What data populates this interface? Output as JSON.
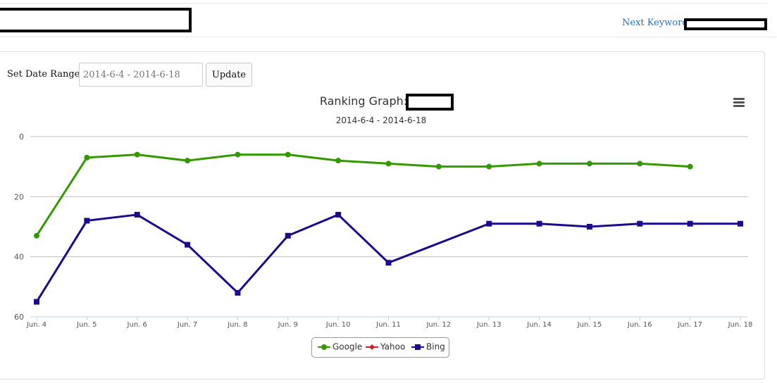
{
  "header": {
    "next_link": "Next Keyword"
  },
  "controls": {
    "date_label": "Set Date Range :",
    "date_value": "2014-6-4 - 2014-6-18",
    "update_label": "Update"
  },
  "chart_data": {
    "type": "line",
    "title": "Ranking Graph:",
    "subtitle": "2014-6-4 - 2014-6-18",
    "categories": [
      "Jun. 4",
      "Jun. 5",
      "Jun. 6",
      "Jun. 7",
      "Jun. 8",
      "Jun. 9",
      "Jun. 10",
      "Jun. 11",
      "Jun. 12",
      "Jun. 13",
      "Jun. 14",
      "Jun. 15",
      "Jun. 16",
      "Jun. 17",
      "Jun. 18"
    ],
    "y_axis": {
      "reversed": true,
      "ylim": [
        0,
        60
      ],
      "ticks": [
        0,
        20,
        40,
        60
      ]
    },
    "grid": true,
    "legend_position": "bottom-center",
    "series": [
      {
        "name": "Google",
        "color": "#339900",
        "marker": "circle",
        "values": [
          33,
          7,
          6,
          8,
          6,
          6,
          8,
          9,
          10,
          10,
          9,
          9,
          9,
          10,
          null
        ]
      },
      {
        "name": "Yahoo",
        "color": "#cc2222",
        "marker": "diamond",
        "values": []
      },
      {
        "name": "Bing",
        "color": "#1a0a8c",
        "marker": "square",
        "values": [
          55,
          28,
          26,
          36,
          52,
          33,
          26,
          42,
          null,
          29,
          29,
          30,
          29,
          29,
          29
        ]
      }
    ]
  }
}
